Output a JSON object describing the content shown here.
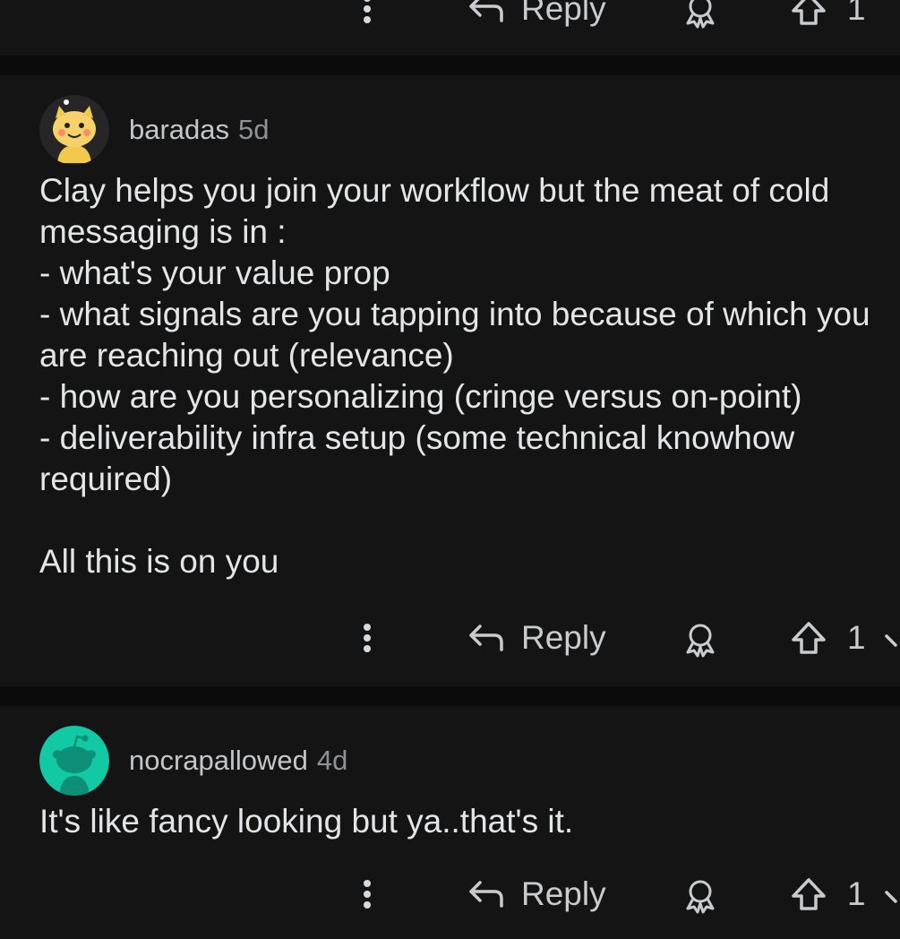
{
  "top_actions": {
    "reply_label": "Reply",
    "upvotes": "1"
  },
  "comments": [
    {
      "username": "baradas",
      "age": "5d",
      "text": "Clay helps you join your workflow but the meat of cold\nmessaging is in :\n- what's your value prop\n- what signals are you tapping into because of which you\nare reaching out (relevance)\n- how are you personalizing (cringe versus on-point)\n- deliverability infra setup (some technical knowhow\nrequired)\n\nAll this is on you",
      "reply_label": "Reply",
      "upvotes": "1",
      "avatar_icon": "snoo-yellow-avatar-icon"
    },
    {
      "username": "nocrapallowed",
      "age": "4d",
      "text": "It's like fancy looking but ya..that's it.",
      "reply_label": "Reply",
      "upvotes": "1",
      "avatar_icon": "snoo-teal-avatar-icon"
    }
  ],
  "colors": {
    "background": "#0b0b0b",
    "card": "#141414",
    "teal_avatar": "#12c9a6",
    "yellow_avatar": "#f2c94c"
  }
}
